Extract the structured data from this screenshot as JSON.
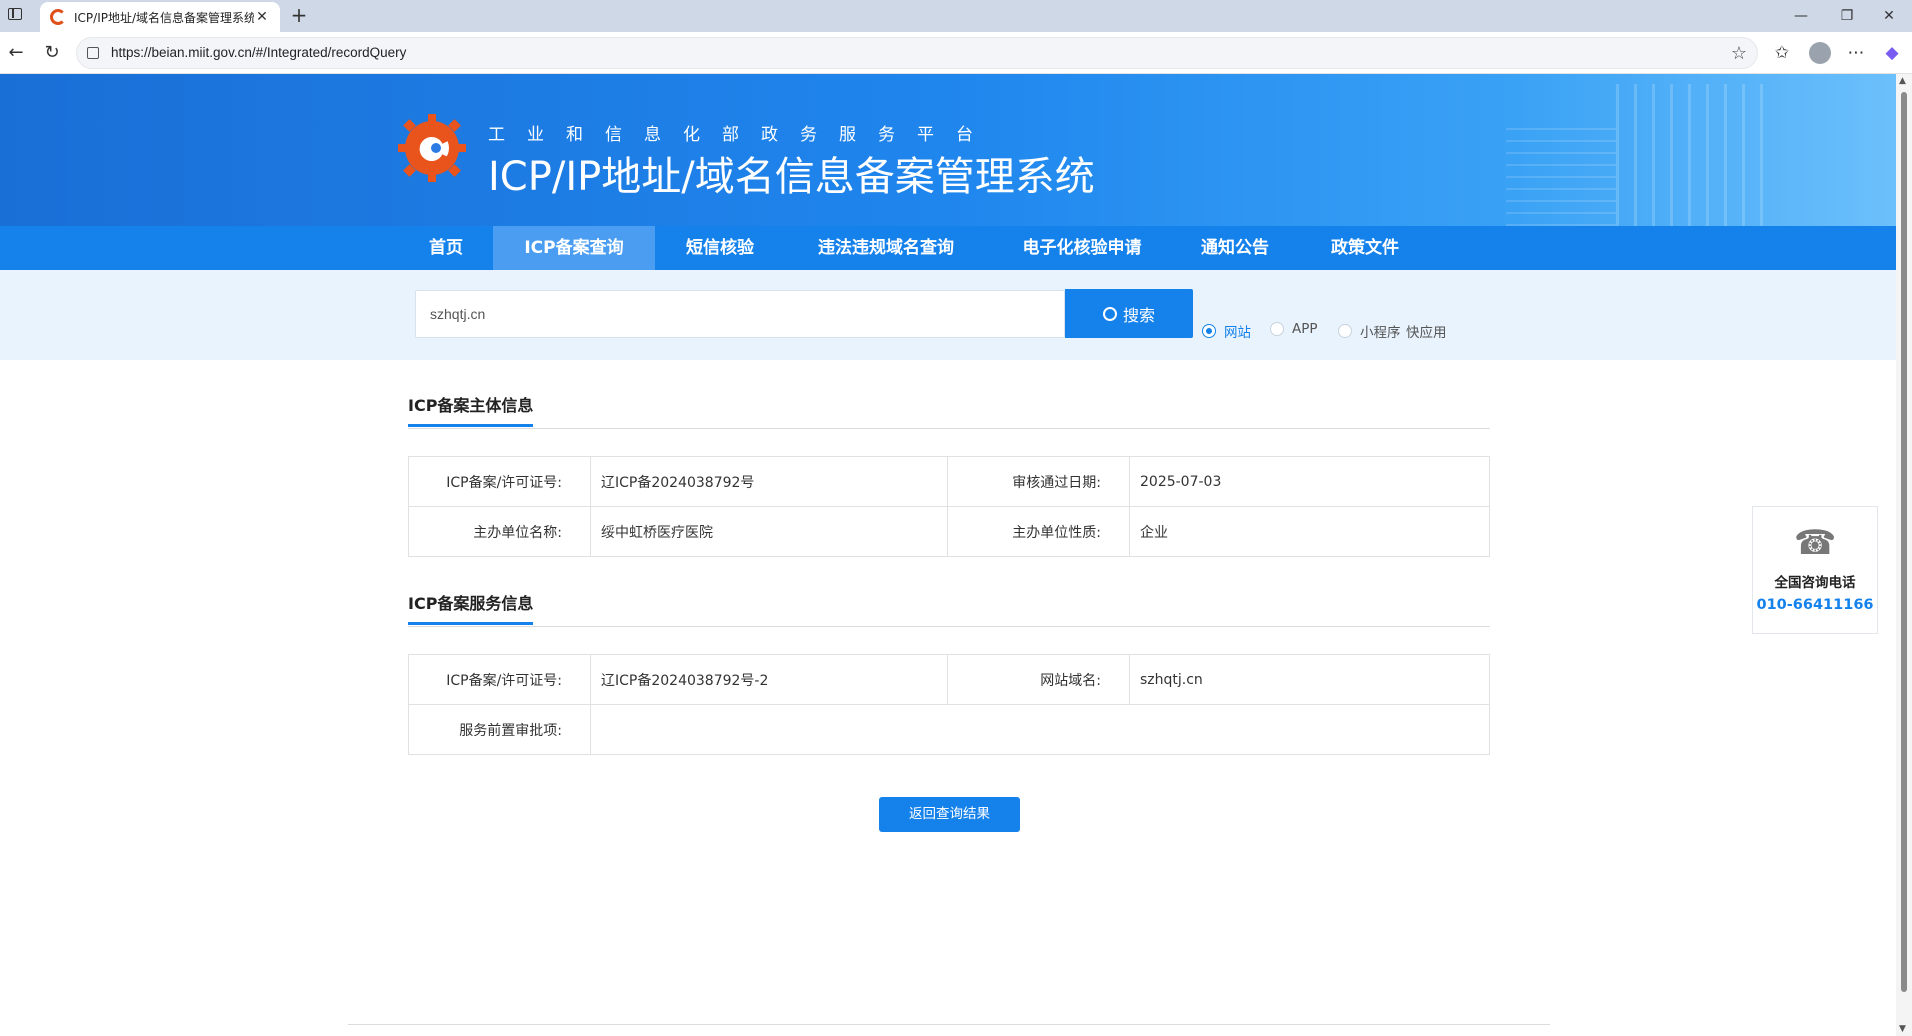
{
  "browser": {
    "tab_title": "ICP/IP地址/域名信息备案管理系统",
    "tab_close": "✕",
    "new_tab": "+",
    "url": "https://beian.miit.gov.cn/#/Integrated/recordQuery",
    "window_controls": {
      "minimize": "—",
      "restore": "❐",
      "close": "✕"
    },
    "nav": {
      "back": "←",
      "reload": "↻"
    },
    "icons": {
      "favorite": "star-icon",
      "collections": "collections-icon",
      "profile": "profile-icon",
      "menu": "more-icon",
      "copilot": "copilot-icon"
    }
  },
  "header": {
    "subtitle": "工业和信息化部政务服务平台",
    "title": "ICP/IP地址/域名信息备案管理系统"
  },
  "nav": {
    "items": [
      {
        "label": "首页"
      },
      {
        "label": "ICP备案查询"
      },
      {
        "label": "短信核验"
      },
      {
        "label": "违法违规域名查询"
      },
      {
        "label": "电子化核验申请"
      },
      {
        "label": "通知公告"
      },
      {
        "label": "政策文件"
      }
    ],
    "active": "ICP备案查询"
  },
  "search": {
    "query": "szhqtj.cn",
    "button_label": "搜索",
    "options": [
      {
        "label": "网站",
        "selected": true
      },
      {
        "label": "APP",
        "selected": false
      },
      {
        "label": "小程序",
        "selected": false
      },
      {
        "label": "快应用",
        "selected": false
      }
    ]
  },
  "subject_info": {
    "title": "ICP备案主体信息",
    "rows": [
      {
        "label1": "ICP备案/许可证号:",
        "value1": "辽ICP备2024038792号",
        "label2": "审核通过日期:",
        "value2": "2025-07-03"
      },
      {
        "label1": "主办单位名称:",
        "value1": "绥中虹桥医疗医院",
        "label2": "主办单位性质:",
        "value2": "企业"
      }
    ]
  },
  "service_info": {
    "title": "ICP备案服务信息",
    "rows": [
      {
        "label1": "ICP备案/许可证号:",
        "value1": "辽ICP备2024038792号-2",
        "label2": "网站域名:",
        "value2": "szhqtj.cn"
      },
      {
        "label1": "服务前置审批项:",
        "value1": ""
      }
    ]
  },
  "back_button": "返回查询结果",
  "hotline": {
    "label": "全国咨询电话",
    "number": "010-66411166"
  },
  "colors": {
    "primary": "#1582ec",
    "nav_active": "#4a9df0",
    "search_band": "#e8f3fd"
  }
}
